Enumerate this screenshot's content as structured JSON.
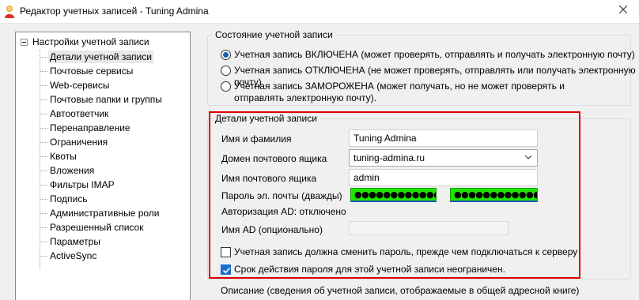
{
  "window": {
    "title": "Редактор учетных записей - Tuning Admina",
    "icon": "mdaemon-app-icon",
    "close_icon": "close-icon"
  },
  "tree": {
    "root_label": "Настройки учетной записи",
    "items": [
      {
        "label": "Детали учетной записи",
        "selected": true
      },
      {
        "label": "Почтовые сервисы"
      },
      {
        "label": "Web-сервисы"
      },
      {
        "label": "Почтовые папки и группы"
      },
      {
        "label": "Автоответчик"
      },
      {
        "label": "Перенаправление"
      },
      {
        "label": "Ограничения"
      },
      {
        "label": "Квоты"
      },
      {
        "label": "Вложения"
      },
      {
        "label": "Фильтры IMAP"
      },
      {
        "label": "Подпись"
      },
      {
        "label": "Административные роли"
      },
      {
        "label": "Разрешенный список"
      },
      {
        "label": "Параметры"
      },
      {
        "label": "ActiveSync"
      }
    ]
  },
  "account_state": {
    "title": "Состояние учетной записи",
    "options": [
      {
        "label": "Учетная запись ВКЛЮЧЕНА (может проверять, отправлять и получать электронную почту)",
        "selected": true
      },
      {
        "label": "Учетная запись ОТКЛЮЧЕНА (не может проверять, отправлять или получать электронную почту)",
        "selected": false
      },
      {
        "label": "Учетная запись ЗАМОРОЖЕНА (может получать, но не может проверять и отправлять электронную почту).",
        "selected": false
      }
    ]
  },
  "details": {
    "title": "Детали учетной записи",
    "full_name_label": "Имя и фамилия",
    "full_name_value": "Tuning Admina",
    "domain_label": "Домен почтового ящика",
    "domain_value": "tuning-admina.ru",
    "mailbox_label": "Имя почтового ящика",
    "mailbox_value": "admin",
    "password_label": "Пароль эл. почты (дважды)",
    "password_value_1": "●●●●●●●●●●●●●●",
    "password_value_2": "●●●●●●●●●●●●●●",
    "ad_auth_label": "Авторизация AD: отключено",
    "ad_name_label": "Имя AD (опционально)",
    "ad_name_value": "",
    "must_change_label": "Учетная запись должна сменить пароль, прежде чем подключаться к серверу",
    "must_change_checked": false,
    "never_expires_label": "Срок действия пароля для этой учетной записи неограничен.",
    "never_expires_checked": true
  },
  "description": {
    "label": "Описание (сведения об учетной записи, отображаемые в общей адресной книге)"
  },
  "colors": {
    "highlight_border": "#e00000",
    "password_fill": "#1ee400",
    "accent": "#1a6ccf"
  }
}
